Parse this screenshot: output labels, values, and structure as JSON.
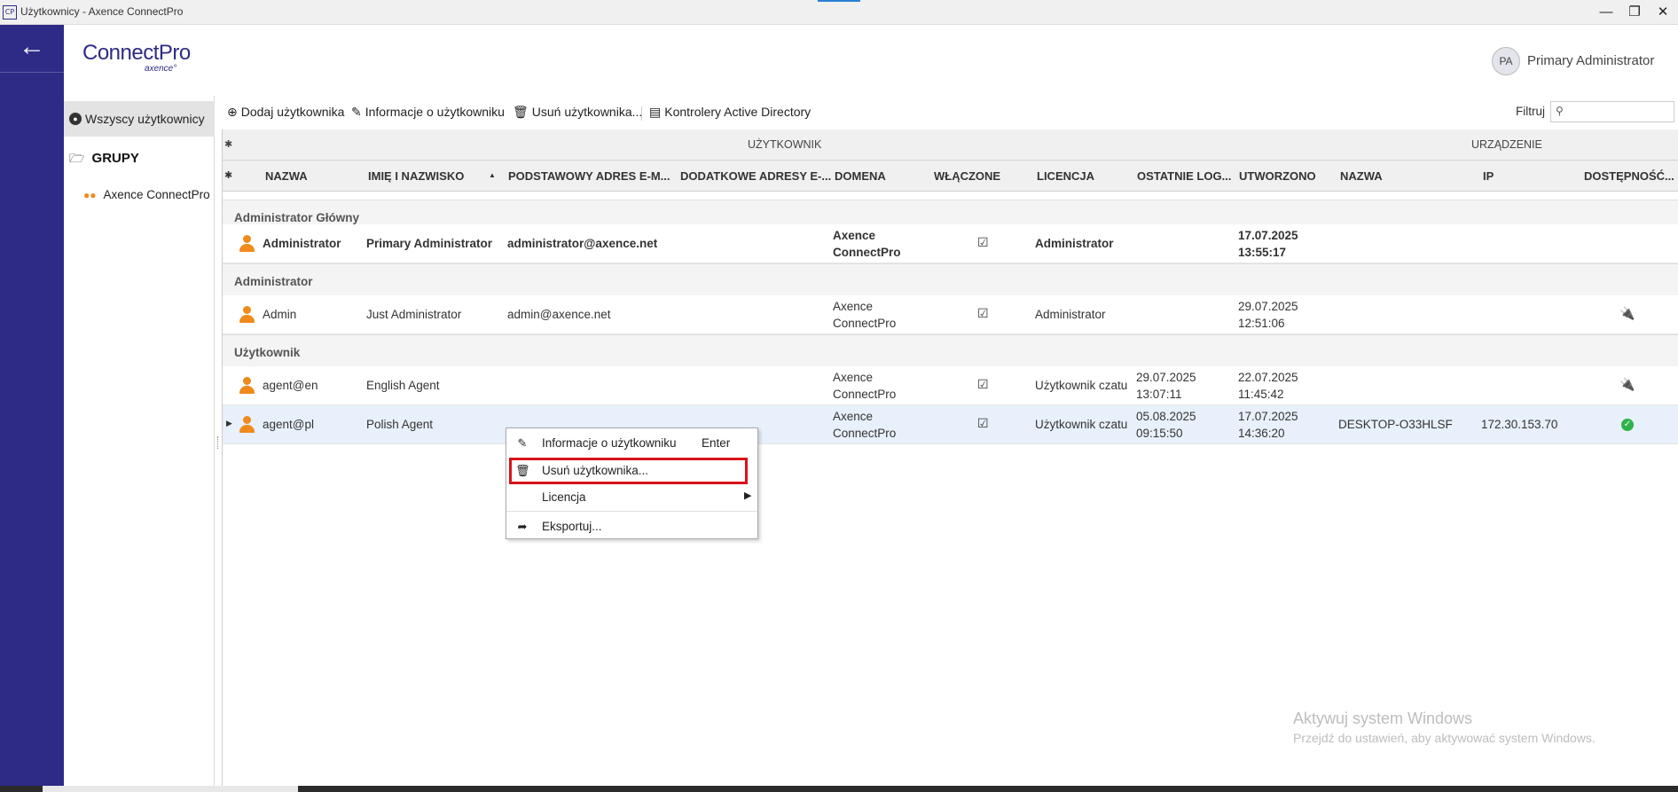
{
  "window": {
    "title": "Użytkownicy - Axence ConnectPro",
    "icon_label": "CP",
    "minimize": "—",
    "restore": "❐",
    "close": "✕"
  },
  "nav": {
    "back_icon": "arrow-left-icon"
  },
  "logo": {
    "brand": "ConnectPro",
    "sub": "axence°"
  },
  "user": {
    "initials": "PA",
    "name": "Primary Administrator"
  },
  "sidebar": {
    "all_users": "Wszyscy użytkownicy",
    "groups_label": "GRUPY",
    "group_items": [
      "Axence ConnectPro"
    ]
  },
  "toolbar": {
    "add": "Dodaj użytkownika",
    "info": "Informacje o użytkowniku",
    "delete": "Usuń użytkownika...",
    "ad": "Kontrolery Active Directory",
    "filter_label": "Filtruj",
    "filter_value": ""
  },
  "grid": {
    "band_user": "UŻYTKOWNIK",
    "band_device": "URZĄDZENIE",
    "headers": {
      "nazwa": "NAZWA",
      "imie": "IMIĘ I NAZWISKO",
      "email": "PODSTAWOWY ADRES E-M...",
      "extra_email": "DODATKOWE ADRESY E-...",
      "domena": "DOMENA",
      "wlaczone": "WŁĄCZONE",
      "licencja": "LICENCJA",
      "ostatnie": "OSTATNIE LOG...",
      "utworzono": "UTWORZONO",
      "dev_nazwa": "NAZWA",
      "ip": "IP",
      "dostepnosc": "DOSTĘPNOŚĆ..."
    },
    "groups": [
      {
        "label": "Administrator Główny",
        "rows": [
          {
            "nazwa": "Administrator",
            "imie": "Primary Administrator",
            "email": "administrator@axence.net",
            "domena1": "Axence",
            "domena2": "ConnectPro",
            "enabled": "☑",
            "licencja": "Administrator",
            "ost1": "",
            "ost2": "",
            "utw1": "17.07.2025",
            "utw2": "13:55:17",
            "dev": "",
            "ip": "",
            "status": ""
          }
        ]
      },
      {
        "label": "Administrator",
        "rows": [
          {
            "nazwa": "Admin",
            "imie": "Just Administrator",
            "email": "admin@axence.net",
            "domena1": "Axence",
            "domena2": "ConnectPro",
            "enabled": "☑",
            "licencja": "Administrator",
            "ost1": "",
            "ost2": "",
            "utw1": "29.07.2025",
            "utw2": "12:51:06",
            "dev": "",
            "ip": "",
            "status": "plug-icon"
          }
        ]
      },
      {
        "label": "Użytkownik",
        "rows": [
          {
            "nazwa": "agent@en",
            "imie": "English Agent",
            "email": "",
            "domena1": "Axence",
            "domena2": "ConnectPro",
            "enabled": "☑",
            "licencja": "Użytkownik czatu",
            "ost1": "29.07.2025",
            "ost2": "13:07:11",
            "utw1": "22.07.2025",
            "utw2": "11:45:42",
            "dev": "",
            "ip": "",
            "status": "plug-icon"
          },
          {
            "nazwa": "agent@pl",
            "imie": "Polish Agent",
            "email": "",
            "domena1": "Axence",
            "domena2": "ConnectPro",
            "enabled": "☑",
            "licencja": "Użytkownik czatu",
            "ost1": "05.08.2025",
            "ost2": "09:15:50",
            "utw1": "17.07.2025",
            "utw2": "14:36:20",
            "dev": "DESKTOP-O33HLSF",
            "ip": "172.30.153.70",
            "status": "online-check-icon"
          }
        ]
      }
    ]
  },
  "context_menu": {
    "info": "Informacje o użytkowniku",
    "info_shortcut": "Enter",
    "delete": "Usuń użytkownika...",
    "license": "Licencja",
    "export": "Eksportuj..."
  },
  "watermark": {
    "line1": "Aktywuj system Windows",
    "line2": "Przejdź do ustawień, aby aktywować system Windows."
  },
  "colors": {
    "nav": "#2e2b86",
    "accent_user": "#f08a1c",
    "highlight": "#d9121a"
  }
}
